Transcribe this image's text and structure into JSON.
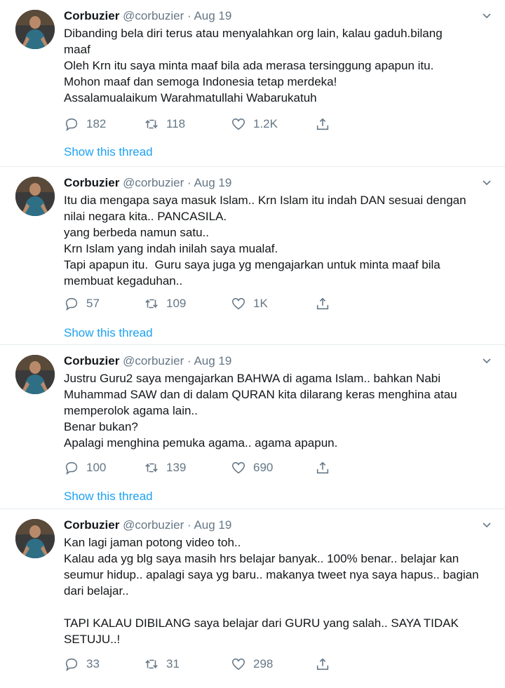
{
  "tweets": [
    {
      "name": "Corbuzier",
      "handle": "@corbuzier",
      "dot": " · ",
      "date": "Aug 19",
      "lines": [
        "Dibanding bela diri terus atau menyalahkan org lain, kalau gaduh.bilang",
        "maaf",
        "Oleh Krn itu saya minta maaf bila ada merasa tersinggung apapun itu.",
        "Mohon maaf dan semoga Indonesia tetap merdeka!",
        "Assalamualaikum Warahmatullahi Wabarukatuh"
      ],
      "replies": "182",
      "retweets": "118",
      "likes": "1.2K",
      "show_thread": "Show this thread"
    },
    {
      "name": "Corbuzier",
      "handle": "@corbuzier",
      "dot": " · ",
      "date": "Aug 19",
      "lines": [
        "Itu dia mengapa saya masuk Islam.. Krn Islam itu indah DAN sesuai dengan",
        "nilai negara kita.. PANCASILA.",
        "yang berbeda namun satu..",
        "Krn Islam yang indah inilah saya mualaf.",
        "Tapi apapun itu.  Guru saya juga yg mengajarkan untuk minta maaf bila",
        "membuat kegaduhan.."
      ],
      "replies": "57",
      "retweets": "109",
      "likes": "1K",
      "show_thread": "Show this thread"
    },
    {
      "name": "Corbuzier",
      "handle": "@corbuzier",
      "dot": " · ",
      "date": "Aug 19",
      "lines": [
        "Justru Guru2 saya mengajarkan BAHWA di agama Islam.. bahkan Nabi",
        "Muhammad SAW dan di dalam QURAN kita dilarang keras menghina atau",
        "memperolok agama lain..",
        "Benar bukan?",
        "Apalagi menghina pemuka agama.. agama apapun."
      ],
      "replies": "100",
      "retweets": "139",
      "likes": "690",
      "show_thread": "Show this thread"
    },
    {
      "name": "Corbuzier",
      "handle": "@corbuzier",
      "dot": " · ",
      "date": "Aug 19",
      "lines": [
        "Kan lagi jaman potong video toh..",
        "Kalau ada yg blg saya masih hrs belajar banyak.. 100% benar.. belajar kan",
        "seumur hidup.. apalagi saya yg baru.. makanya tweet nya saya hapus.. bagian",
        "dari belajar..",
        "",
        "TAPI KALAU DIBILANG saya belajar dari GURU yang salah.. SAYA TIDAK",
        "SETUJU..!"
      ],
      "replies": "33",
      "retweets": "31",
      "likes": "298",
      "show_thread": ""
    }
  ],
  "icons": {
    "reply": "reply-icon",
    "retweet": "retweet-icon",
    "like": "heart-icon",
    "share": "share-icon",
    "more": "chevron-down-icon"
  },
  "colors": {
    "text": "#14171a",
    "muted": "#657786",
    "link": "#1da1f2",
    "divider": "#e6ecf0"
  }
}
